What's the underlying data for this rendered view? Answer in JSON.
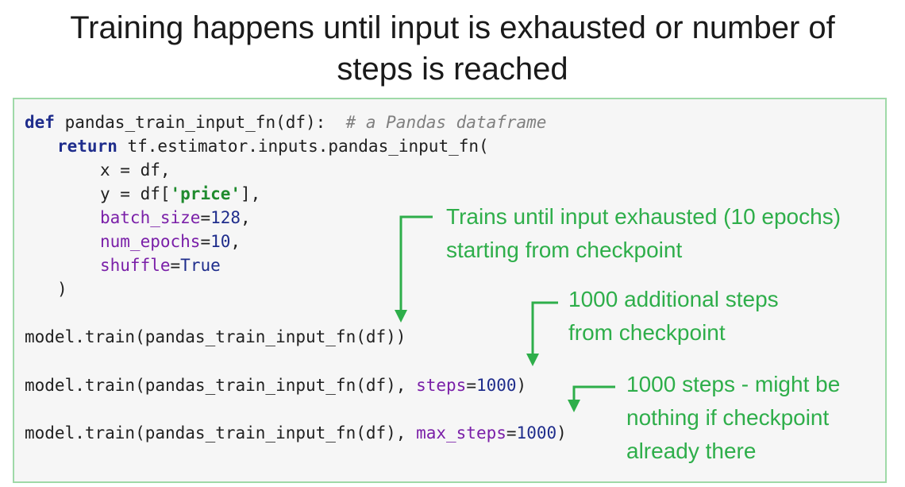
{
  "title": {
    "line1": "Training happens until input is exhausted or number of",
    "line2": "steps is reached"
  },
  "code": {
    "l1_kw": "def",
    "l1_rest": " pandas_train_input_fn(df):  ",
    "l1_comment": "# a Pandas dataframe",
    "l2_kw": "return",
    "l2_rest": " tf.estimator.inputs.pandas_input_fn(",
    "l3": "x = df,",
    "l4_pre": "y = df[",
    "l4_str": "'price'",
    "l4_post": "],",
    "l5_arg": "batch_size",
    "l5_eq": "=",
    "l5_val": "128",
    "l5_post": ",",
    "l6_arg": "num_epochs",
    "l6_eq": "=",
    "l6_val": "10",
    "l6_post": ",",
    "l7_arg": "shuffle",
    "l7_eq": "=",
    "l7_val": "True",
    "l8": ")",
    "l9": "model.train(pandas_train_input_fn(df))",
    "l10_pre": "model.train(pandas_train_input_fn(df), ",
    "l10_arg": "steps",
    "l10_eq": "=",
    "l10_val": "1000",
    "l10_post": ")",
    "l11_pre": "model.train(pandas_train_input_fn(df), ",
    "l11_arg": "max_steps",
    "l11_eq": "=",
    "l11_val": "1000",
    "l11_post": ")"
  },
  "annotations": {
    "note1": [
      "Trains until input exhausted (10 epochs)",
      "starting from checkpoint"
    ],
    "note2": [
      "1000 additional steps",
      "from checkpoint"
    ],
    "note3": [
      "1000 steps - might be",
      "nothing if checkpoint",
      "already there"
    ]
  },
  "colors": {
    "annotation": "#2eae4a",
    "keyword": "#1f2d8c",
    "argument": "#7a1fa8",
    "string": "#1f8b2e",
    "comment": "#7f7f7f"
  }
}
